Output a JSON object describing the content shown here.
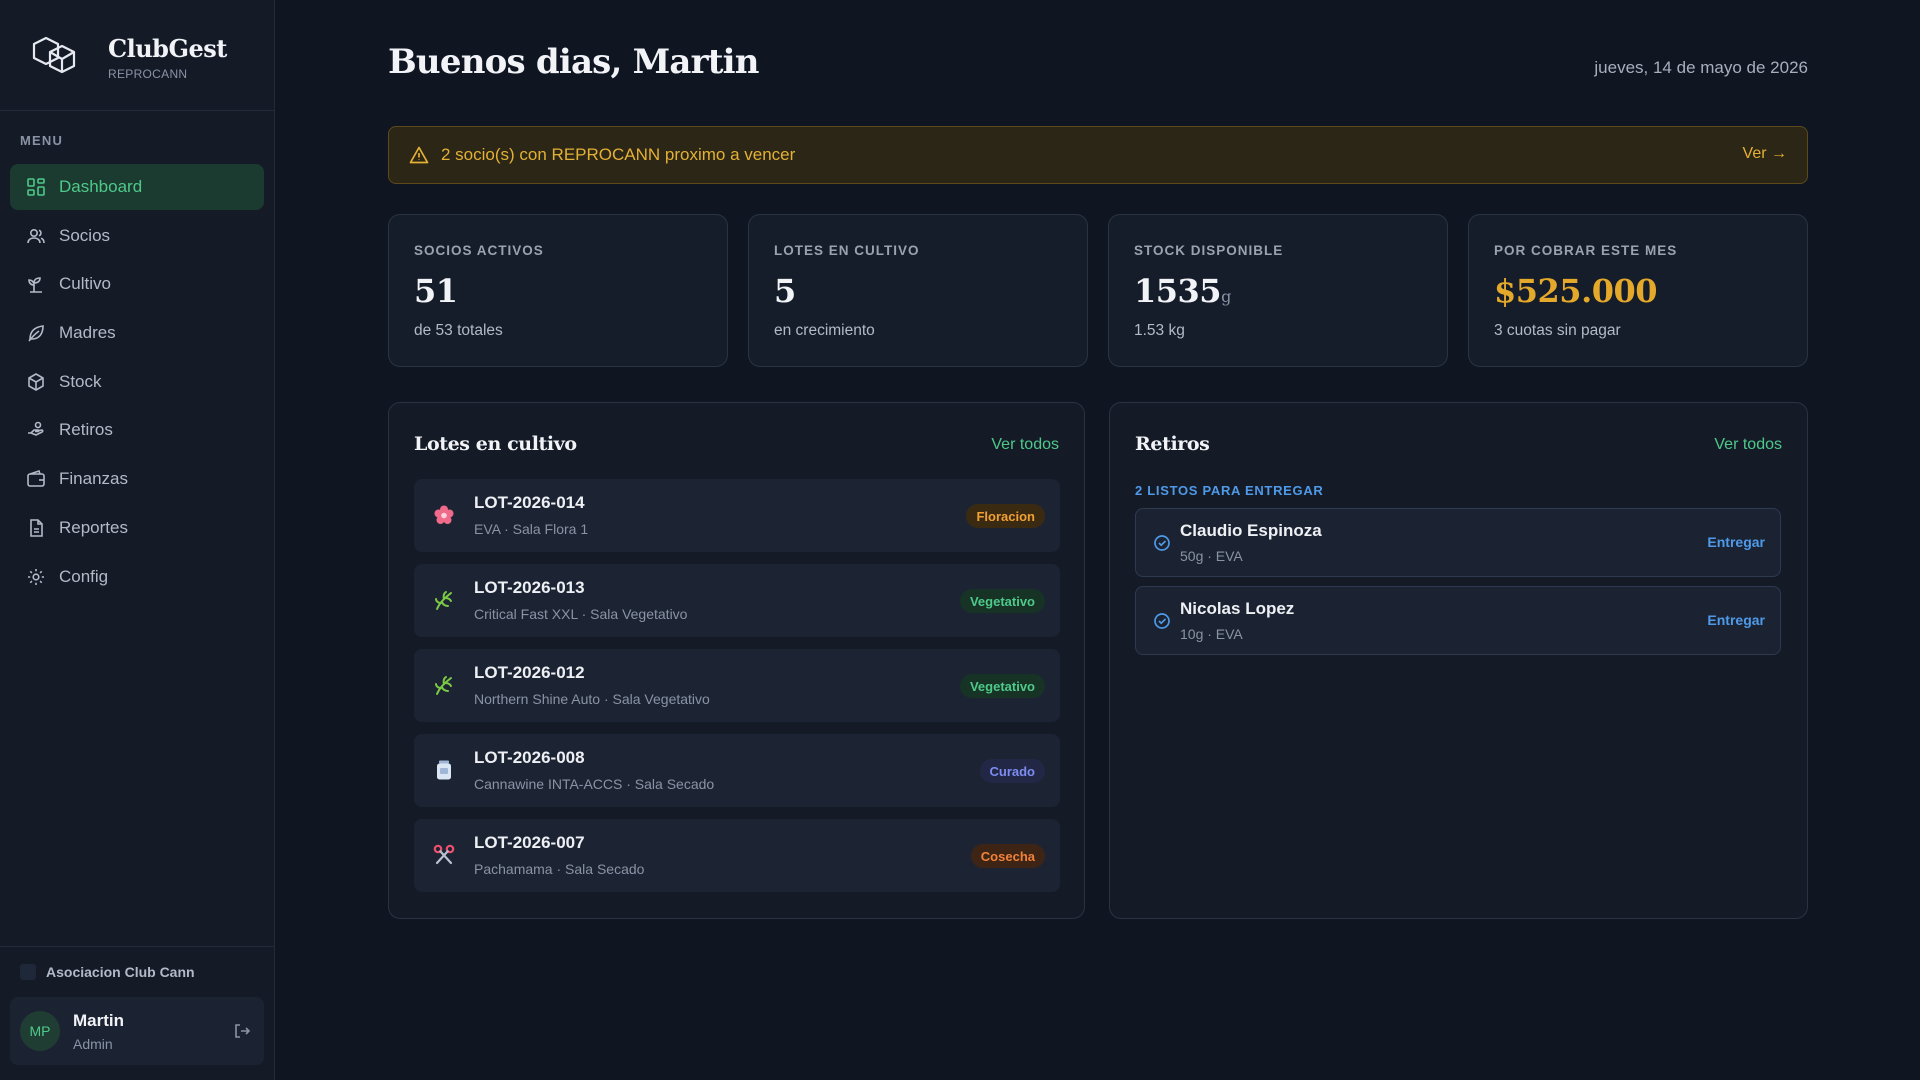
{
  "brand": {
    "name": "ClubGest",
    "subtitle": "REPROCANN"
  },
  "sidebar": {
    "menu_title": "MENU",
    "items": [
      {
        "label": "Dashboard",
        "icon": "grid-icon",
        "active": true
      },
      {
        "label": "Socios",
        "icon": "users-icon"
      },
      {
        "label": "Cultivo",
        "icon": "sprout-icon"
      },
      {
        "label": "Madres",
        "icon": "leaf-icon"
      },
      {
        "label": "Stock",
        "icon": "box-icon"
      },
      {
        "label": "Retiros",
        "icon": "hand-icon"
      },
      {
        "label": "Finanzas",
        "icon": "wallet-icon"
      },
      {
        "label": "Reportes",
        "icon": "file-icon"
      },
      {
        "label": "Config",
        "icon": "gear-icon"
      }
    ],
    "org_name": "Asociacion Club Cann",
    "user": {
      "initials": "MP",
      "name": "Martin",
      "role": "Admin"
    }
  },
  "header": {
    "greeting": "Buenos dias, Martin",
    "date": "jueves, 14 de mayo de 2026"
  },
  "alert": {
    "text": "2 socio(s) con REPROCANN proximo a vencer",
    "link": "Ver →"
  },
  "stats": [
    {
      "label": "SOCIOS ACTIVOS",
      "value": "51",
      "sub": "de 53 totales"
    },
    {
      "label": "LOTES EN CULTIVO",
      "value": "5",
      "sub": "en crecimiento"
    },
    {
      "label": "STOCK DISPONIBLE",
      "value": "1535",
      "unit": "g",
      "sub": "1.53 kg"
    },
    {
      "label": "POR COBRAR ESTE MES",
      "value": "$525.000",
      "sub": "3 cuotas sin pagar",
      "accent": "#e4a82a"
    }
  ],
  "lotes": {
    "title": "Lotes en cultivo",
    "link": "Ver todos",
    "items": [
      {
        "id": "LOT-2026-014",
        "desc": "EVA · Sala Flora 1",
        "status": "Floracion",
        "icon": "flower-icon"
      },
      {
        "id": "LOT-2026-013",
        "desc": "Critical Fast XXL · Sala Vegetativo",
        "status": "Vegetativo",
        "icon": "herb-icon"
      },
      {
        "id": "LOT-2026-012",
        "desc": "Northern Shine Auto · Sala Vegetativo",
        "status": "Vegetativo",
        "icon": "herb-icon"
      },
      {
        "id": "LOT-2026-008",
        "desc": "Cannawine INTA-ACCS · Sala Secado",
        "status": "Curado",
        "icon": "jar-icon"
      },
      {
        "id": "LOT-2026-007",
        "desc": "Pachamama · Sala Secado",
        "status": "Cosecha",
        "icon": "scissors-icon"
      }
    ]
  },
  "retiros": {
    "title": "Retiros",
    "link": "Ver todos",
    "ready_label": "2 LISTOS PARA ENTREGAR",
    "items": [
      {
        "name": "Claudio Espinoza",
        "desc": "50g · EVA",
        "action": "Entregar"
      },
      {
        "name": "Nicolas Lopez",
        "desc": "10g · EVA",
        "action": "Entregar"
      }
    ]
  }
}
